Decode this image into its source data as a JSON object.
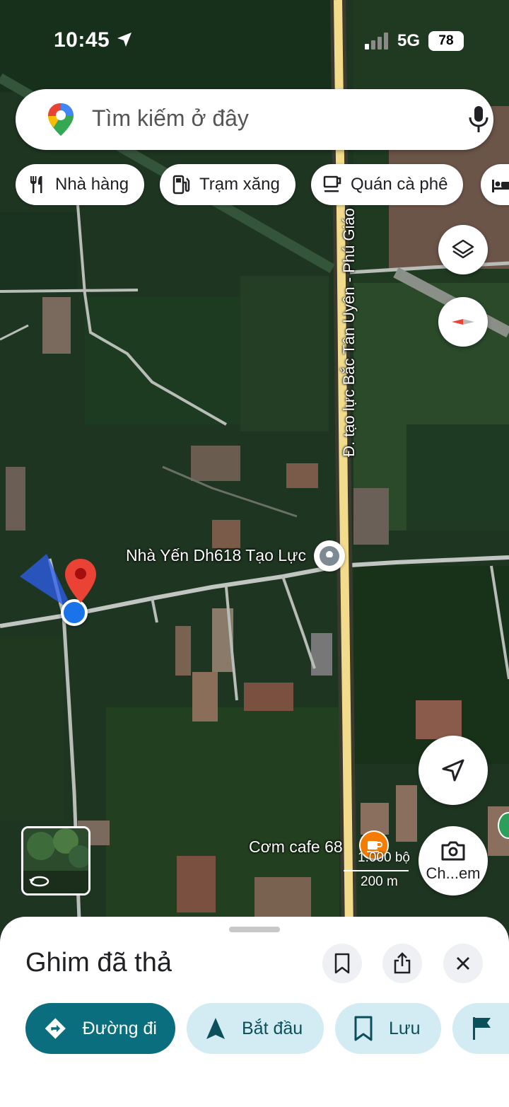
{
  "status_bar": {
    "time": "10:45",
    "network": "5G",
    "battery": "78"
  },
  "search": {
    "placeholder": "Tìm kiếm ở đây"
  },
  "chips": [
    {
      "label": "Nhà hàng",
      "icon": "restaurant-icon"
    },
    {
      "label": "Trạm xăng",
      "icon": "gas-station-icon"
    },
    {
      "label": "Quán cà phê",
      "icon": "coffee-icon"
    },
    {
      "label": "",
      "icon": "hotel-icon"
    }
  ],
  "map": {
    "road_name": "Đ. tạo lực Bắc Tân Uyên - Phú Giáo",
    "places": [
      {
        "name": "Nhà Yến Dh618 Tạo Lực",
        "icon": "place-pin-icon"
      },
      {
        "name": "Cơm cafe 68",
        "icon": "cafe-icon"
      }
    ],
    "scale": {
      "feet": "1.000 bộ",
      "meters": "200 m"
    },
    "street_view_label": "Ch...em",
    "colors": {
      "user_dot": "#1a73e8",
      "dropped_pin": "#ea4335",
      "cafe_marker": "#f57c00"
    }
  },
  "sheet": {
    "title": "Ghim đã thả",
    "actions": [
      {
        "label": "Đường đi",
        "icon": "directions-icon"
      },
      {
        "label": "Bắt đầu",
        "icon": "navigation-icon"
      },
      {
        "label": "Lưu",
        "icon": "bookmark-icon"
      },
      {
        "label": "",
        "icon": "flag-icon"
      }
    ],
    "accent": "#0b6e7e"
  }
}
